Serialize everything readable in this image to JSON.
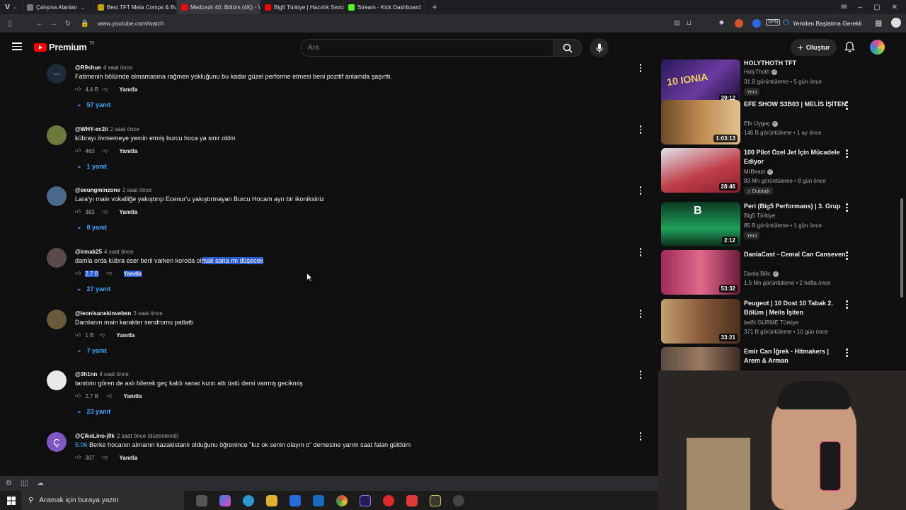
{
  "browser": {
    "tabs": [
      {
        "label": "Çalışma Alanları",
        "color": "#555"
      },
      {
        "label": "Best TFT Meta Comps & Bu",
        "color": "#c8a000"
      },
      {
        "label": "Medcezir 40. Bölüm (4K) - Y",
        "color": "#ff0000"
      },
      {
        "label": "Big5 Türkiye | Hazırlık Sezo",
        "color": "#ff0000"
      },
      {
        "label": "Stream - Kick Dashboard",
        "color": "#53fc18"
      }
    ],
    "new_tab": "+",
    "url": "www.youtube.com/watch",
    "restart_label": "Yeniden Başlatma Gerekli",
    "vpn_label": "VPN"
  },
  "masthead": {
    "logo_text": "Premium",
    "logo_sup": "TR",
    "search_placeholder": "Ara",
    "create_label": "Oluştur"
  },
  "comments": [
    {
      "handle": "@R9shue",
      "ago": "4 saat önce",
      "text": "Fatimenin bölümde olmamasına rağmen yokluğunu bu kadar güzel performe etmesi beni pozitif anlamda şaşırttı.",
      "likes": "4,4 B",
      "reply": "Yanıtla",
      "replies": "57 yanıt",
      "avatar_color": "#1c2a3a"
    },
    {
      "handle": "@WHY-ec2ii",
      "ago": "2 saat önce",
      "text": "kübrayı övmemeye yemin etmiş burcu hoca ya sinir oldm",
      "likes": "463",
      "reply": "Yanıtla",
      "replies": "1 yanıt",
      "avatar_color": "#6b7a3c"
    },
    {
      "handle": "@seungminzone",
      "ago": "2 saat önce",
      "text": "Lara'yı main vokalliğe yakıştırıp Ecenur'u yakıştırmayan Burcu Hocam ayrı bir ikoniksiniz",
      "likes": "382",
      "reply": "Yanıtla",
      "replies": "8 yanıt",
      "avatar_color": "#4a6a8a"
    },
    {
      "handle": "@irmak25",
      "ago": "4 saat önce",
      "text_plain": "damla orda kübra eser beril varken koroda ol",
      "text_sel": "mak sana mı düşecek",
      "likes": "2,7 B",
      "reply": "Yanıtla",
      "replies": "27 yanıt",
      "avatar_color": "#5a4a48"
    },
    {
      "handle": "@leonisanekinveben",
      "ago": "3 saat önce",
      "text": "Damlanın main karakter sendromu patlattı",
      "likes": "1 B",
      "reply": "Yanıtla",
      "replies": "7 yanıt",
      "avatar_color": "#6a5a3a"
    },
    {
      "handle": "@3h1nn",
      "ago": "4 saat önce",
      "text": "tanıtımı gören de aslı bilerek geç kaldı sanar kızın altı üstü dersi varmış gecikmiş",
      "likes": "2,7 B",
      "reply": "Yanıtla",
      "replies": "23 yanıt",
      "avatar_color": "#e8e8e8"
    },
    {
      "handle": "@ÇikoLino-j9k",
      "ago": "2 saat önce (düzenlendi)",
      "timestamp": "5:06",
      "text": "Berke hocanın alınanın kazakistanlı olduğunu öğrenince \"kız ok senin olayın o\" demesine yarım saat falan güldüm",
      "likes": "307",
      "reply": "Yanıtla",
      "avatar_letter": "Ç",
      "avatar_color": "#7e57c2"
    }
  ],
  "sidebar": [
    {
      "title": "HOLYTHOTH TFT",
      "channel": "HolyThoth",
      "meta": "31 B görüntüleme • 5 gün önce",
      "badge": "Yeni",
      "duration": "39:12",
      "thumb": "#3b2a6a"
    },
    {
      "title": "EFE SHOW S3B03 | MELİS İŞİTEN",
      "channel": "Efe Uygaç",
      "meta": "146 B görüntüleme • 1 ay önce",
      "duration": "1:03:13",
      "thumb": "#7a5a3a"
    },
    {
      "title": "100 Pilot Özel Jet İçin Mücadele Ediyor",
      "channel": "MrBeast",
      "meta": "83 Mn görüntüleme • 8 gün önce",
      "badge": "Dublajlı",
      "duration": "28:46",
      "thumb": "#b84a5a"
    },
    {
      "title": "Peri (Big5 Performans) | 3. Grup",
      "channel": "Big5 Türkiye",
      "meta": "85 B görüntüleme • 1 gün önce",
      "badge": "Yeni",
      "duration": "2:12",
      "thumb": "#1f7a4a"
    },
    {
      "title": "DanlaCast - Cemal Can Canseven",
      "channel": "Danla Bilic",
      "meta": "1,5 Mn görüntüleme • 2 hafta önce",
      "duration": "53:32",
      "thumb": "#c0406a"
    },
    {
      "title": "Peugeot | 10 Dost 10 Tabak 2. Bölüm | Melis İşiten",
      "channel": "beIN GURME Türkiye",
      "meta": "371 B görüntüleme • 10 gün önce",
      "duration": "33:21",
      "thumb": "#8a6a4a"
    },
    {
      "title": "Emir Can İğrek - Hitmakers | Arem & Arman",
      "channel": "",
      "meta": "",
      "duration": "",
      "thumb": "#5a4a40"
    }
  ],
  "taskbar": {
    "search_placeholder": "Aramak için buraya yazın"
  }
}
